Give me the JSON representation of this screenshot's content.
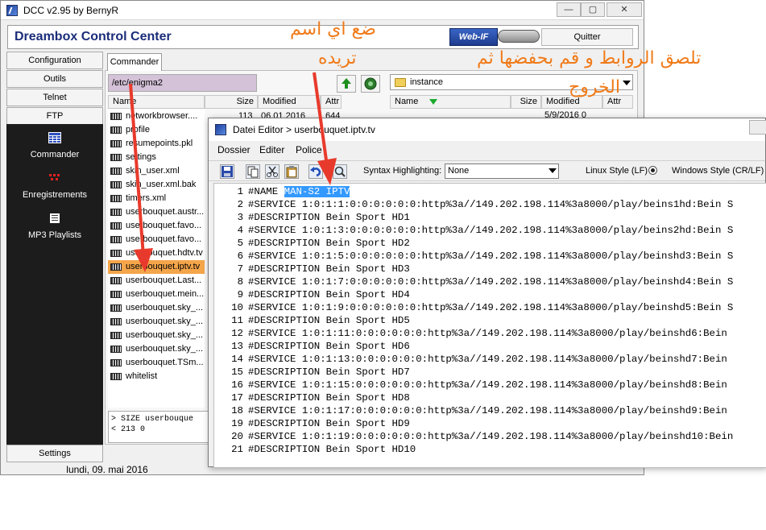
{
  "app": {
    "title": "DCC v2.95 by BernyR",
    "brand": "Dreambox Control Center",
    "webif_label": "Web-IF",
    "quit_label": "Quitter",
    "window_minimize": "—",
    "window_maximize": "▢",
    "window_close": "✕"
  },
  "nav": {
    "top_items": [
      "Configuration",
      "Outils",
      "Telnet",
      "FTP"
    ],
    "dark_items": [
      {
        "label": "Commander",
        "icon": "grid-icon"
      },
      {
        "label": "Enregistrements",
        "icon": "record-icon"
      },
      {
        "label": "MP3 Playlists",
        "icon": "playlist-icon"
      }
    ],
    "settings_label": "Settings"
  },
  "commander": {
    "tab_label": "Commander",
    "left_path": "/etc/enigma2",
    "left_columns": [
      "Name",
      "Size",
      "Modified",
      "Attr"
    ],
    "left_first_row": {
      "size": "113",
      "modified": "06.01.2016",
      "attr": "644"
    },
    "files": [
      "networkbrowser....",
      "profile",
      "resumepoints.pkl",
      "settings",
      "skin_user.xml",
      "skin_user.xml.bak",
      "timers.xml",
      "userbouquet.austr...",
      "userbouquet.favo...",
      "userbouquet.favo...",
      "userbouquet.hdtv.tv",
      "userbouquet.iptv.tv",
      "userbouquet.Last...",
      "userbouquet.mein...",
      "userbouquet.sky_...",
      "userbouquet.sky_...",
      "userbouquet.sky_...",
      "userbouquet.sky_...",
      "userbouquet.TSm...",
      "whitelist"
    ],
    "selected_index": 11,
    "cmdline": "> SIZE userbouque\n< 213 0",
    "right_path": "instance",
    "right_columns": [
      "Name",
      "Size",
      "Modified",
      "Attr"
    ],
    "right_first_row": {
      "modified": "5/9/2016 0"
    }
  },
  "status": {
    "date": "lundi, 09. mai 2016"
  },
  "editor": {
    "title": "Datei Editor > userbouquet.iptv.tv",
    "menu": [
      "Dossier",
      "Editer",
      "Police"
    ],
    "syntax_label": "Syntax Highlighting:",
    "syntax_value": "None",
    "lf_label": "Linux Style (LF)",
    "crlf_label": "Windows Style (CR/LF)",
    "lines": [
      {
        "n": "1",
        "text": "#NAME ",
        "hl": "MAN-S2 IPTV"
      },
      {
        "n": "2",
        "text": "#SERVICE 1:0:1:1:0:0:0:0:0:0:http%3a//149.202.198.114%3a8000/play/beins1hd:Bein S"
      },
      {
        "n": "3",
        "text": "#DESCRIPTION Bein Sport HD1"
      },
      {
        "n": "4",
        "text": "#SERVICE 1:0:1:3:0:0:0:0:0:0:http%3a//149.202.198.114%3a8000/play/beins2hd:Bein S"
      },
      {
        "n": "5",
        "text": "#DESCRIPTION Bein Sport HD2"
      },
      {
        "n": "6",
        "text": "#SERVICE 1:0:1:5:0:0:0:0:0:0:http%3a//149.202.198.114%3a8000/play/beinshd3:Bein S"
      },
      {
        "n": "7",
        "text": "#DESCRIPTION Bein Sport HD3"
      },
      {
        "n": "8",
        "text": "#SERVICE 1:0:1:7:0:0:0:0:0:0:http%3a//149.202.198.114%3a8000/play/beinshd4:Bein S"
      },
      {
        "n": "9",
        "text": "#DESCRIPTION Bein Sport HD4"
      },
      {
        "n": "10",
        "text": "#SERVICE 1:0:1:9:0:0:0:0:0:0:http%3a//149.202.198.114%3a8000/play/beinshd5:Bein S"
      },
      {
        "n": "11",
        "text": "#DESCRIPTION Bein Sport HD5"
      },
      {
        "n": "12",
        "text": "#SERVICE 1:0:1:11:0:0:0:0:0:0:http%3a//149.202.198.114%3a8000/play/beinshd6:Bein"
      },
      {
        "n": "13",
        "text": "#DESCRIPTION Bein Sport HD6"
      },
      {
        "n": "14",
        "text": "#SERVICE 1:0:1:13:0:0:0:0:0:0:http%3a//149.202.198.114%3a8000/play/beinshd7:Bein"
      },
      {
        "n": "15",
        "text": "#DESCRIPTION Bein Sport HD7"
      },
      {
        "n": "16",
        "text": "#SERVICE 1:0:1:15:0:0:0:0:0:0:http%3a//149.202.198.114%3a8000/play/beinshd8:Bein"
      },
      {
        "n": "17",
        "text": "#DESCRIPTION Bein Sport HD8"
      },
      {
        "n": "18",
        "text": "#SERVICE 1:0:1:17:0:0:0:0:0:0:http%3a//149.202.198.114%3a8000/play/beinshd9:Bein"
      },
      {
        "n": "19",
        "text": "#DESCRIPTION Bein Sport HD9"
      },
      {
        "n": "20",
        "text": "#SERVICE 1:0:1:19:0:0:0:0:0:0:http%3a//149.202.198.114%3a8000/play/beinshd10:Bein"
      },
      {
        "n": "21",
        "text": "#DESCRIPTION Bein Sport HD10"
      }
    ]
  },
  "annotations": {
    "name_hint_line1": "ضع اي اسم",
    "name_hint_line2": "تريده",
    "paste_hint_line1": "تلصق الروابط و قم بحفضها ثم",
    "paste_hint_line2": "الخروج",
    "color": "#f07a18",
    "arrow_color": "#e83a2c"
  },
  "colors": {
    "selected_file": "#f5a54a",
    "path_bg": "#d4c2d8",
    "nav_dark": "#1c1c1c",
    "brand_text": "#1b2d7a",
    "highlight": "#3399ff"
  }
}
